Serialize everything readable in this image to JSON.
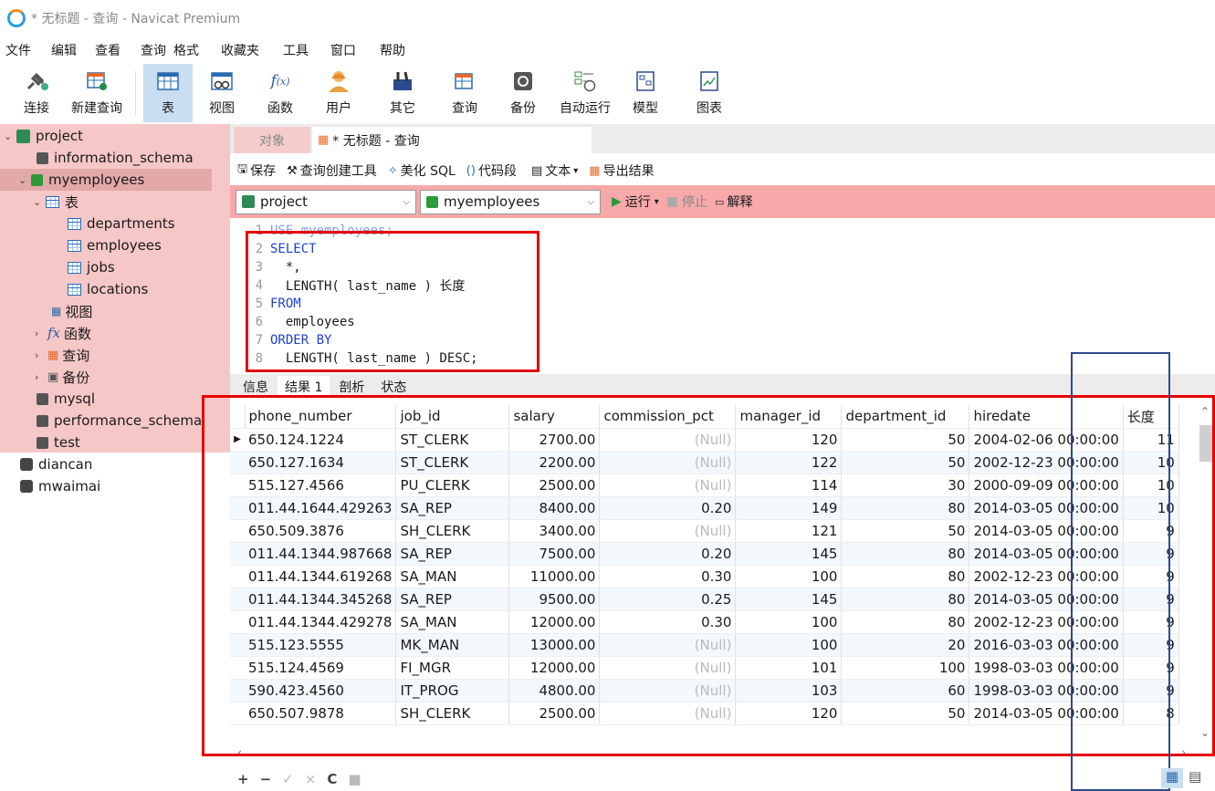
{
  "window": {
    "title": "* 无标题 - 查询 - Navicat Premium"
  },
  "menu": [
    "文件",
    "编辑",
    "查看",
    "查询",
    "格式",
    "收藏夹",
    "工具",
    "窗口",
    "帮助"
  ],
  "toolbar": [
    {
      "label": "连接",
      "icon": "plug-icon"
    },
    {
      "label": "新建查询",
      "icon": "new-query-icon"
    },
    {
      "label": "表",
      "icon": "table-icon",
      "active": true
    },
    {
      "label": "视图",
      "icon": "view-icon"
    },
    {
      "label": "函数",
      "icon": "function-icon"
    },
    {
      "label": "用户",
      "icon": "user-icon"
    },
    {
      "label": "其它",
      "icon": "tools-icon"
    },
    {
      "label": "查询",
      "icon": "query-icon"
    },
    {
      "label": "备份",
      "icon": "backup-icon"
    },
    {
      "label": "自动运行",
      "icon": "schedule-icon"
    },
    {
      "label": "模型",
      "icon": "model-icon"
    },
    {
      "label": "图表",
      "icon": "chart-icon"
    }
  ],
  "tree": {
    "project": "project",
    "information_schema": "information_schema",
    "myemployees": "myemployees",
    "tables_folder": "表",
    "tables": [
      "departments",
      "employees",
      "jobs",
      "locations"
    ],
    "views_folder": "视图",
    "functions_folder": "函数",
    "queries_folder": "查询",
    "backups_folder": "备份",
    "mysql": "mysql",
    "performance_schema": "performance_schema",
    "test": "test",
    "diancan": "diancan",
    "mwaimai": "mwaimai"
  },
  "tabs": {
    "objects": "对象",
    "query": "* 无标题 - 查询"
  },
  "query_toolbar": {
    "save": "保存",
    "builder": "查询创建工具",
    "beautify": "美化 SQL",
    "snippet": "代码段",
    "text": "文本",
    "export": "导出结果"
  },
  "selectors": {
    "connection": "project",
    "database": "myemployees",
    "run": "运行",
    "stop": "停止",
    "explain": "解释"
  },
  "sql_lines": [
    {
      "n": "1",
      "text": "USE myemployees;"
    },
    {
      "n": "2",
      "text": "SELECT"
    },
    {
      "n": "3",
      "text": "  *,"
    },
    {
      "n": "4",
      "text": "  LENGTH( last_name ) 长度"
    },
    {
      "n": "5",
      "text": "FROM"
    },
    {
      "n": "6",
      "text": "  employees"
    },
    {
      "n": "7",
      "text": "ORDER BY"
    },
    {
      "n": "8",
      "text": "  LENGTH( last_name ) DESC;"
    }
  ],
  "result_tabs": [
    "信息",
    "结果 1",
    "剖析",
    "状态"
  ],
  "grid": {
    "columns": [
      "phone_number",
      "job_id",
      "salary",
      "commission_pct",
      "manager_id",
      "department_id",
      "hiredate",
      "长度"
    ],
    "rows": [
      [
        "650.124.1224",
        "ST_CLERK",
        "2700.00",
        "(Null)",
        "120",
        "50",
        "2004-02-06 00:00:00",
        "11"
      ],
      [
        "650.127.1634",
        "ST_CLERK",
        "2200.00",
        "(Null)",
        "122",
        "50",
        "2002-12-23 00:00:00",
        "10"
      ],
      [
        "515.127.4566",
        "PU_CLERK",
        "2500.00",
        "(Null)",
        "114",
        "30",
        "2000-09-09 00:00:00",
        "10"
      ],
      [
        "011.44.1644.429263",
        "SA_REP",
        "8400.00",
        "0.20",
        "149",
        "80",
        "2014-03-05 00:00:00",
        "10"
      ],
      [
        "650.509.3876",
        "SH_CLERK",
        "3400.00",
        "(Null)",
        "121",
        "50",
        "2014-03-05 00:00:00",
        "9"
      ],
      [
        "011.44.1344.987668",
        "SA_REP",
        "7500.00",
        "0.20",
        "145",
        "80",
        "2014-03-05 00:00:00",
        "9"
      ],
      [
        "011.44.1344.619268",
        "SA_MAN",
        "11000.00",
        "0.30",
        "100",
        "80",
        "2002-12-23 00:00:00",
        "9"
      ],
      [
        "011.44.1344.345268",
        "SA_REP",
        "9500.00",
        "0.25",
        "145",
        "80",
        "2014-03-05 00:00:00",
        "9"
      ],
      [
        "011.44.1344.429278",
        "SA_MAN",
        "12000.00",
        "0.30",
        "100",
        "80",
        "2002-12-23 00:00:00",
        "9"
      ],
      [
        "515.123.5555",
        "MK_MAN",
        "13000.00",
        "(Null)",
        "100",
        "20",
        "2016-03-03 00:00:00",
        "9"
      ],
      [
        "515.124.4569",
        "FI_MGR",
        "12000.00",
        "(Null)",
        "101",
        "100",
        "1998-03-03 00:00:00",
        "9"
      ],
      [
        "590.423.4560",
        "IT_PROG",
        "4800.00",
        "(Null)",
        "103",
        "60",
        "1998-03-03 00:00:00",
        "9"
      ],
      [
        "650.507.9878",
        "SH_CLERK",
        "2500.00",
        "(Null)",
        "120",
        "50",
        "2014-03-05 00:00:00",
        "8"
      ]
    ]
  },
  "bottom_controls": [
    "+",
    "−",
    "✓",
    "×",
    "C",
    "■"
  ]
}
